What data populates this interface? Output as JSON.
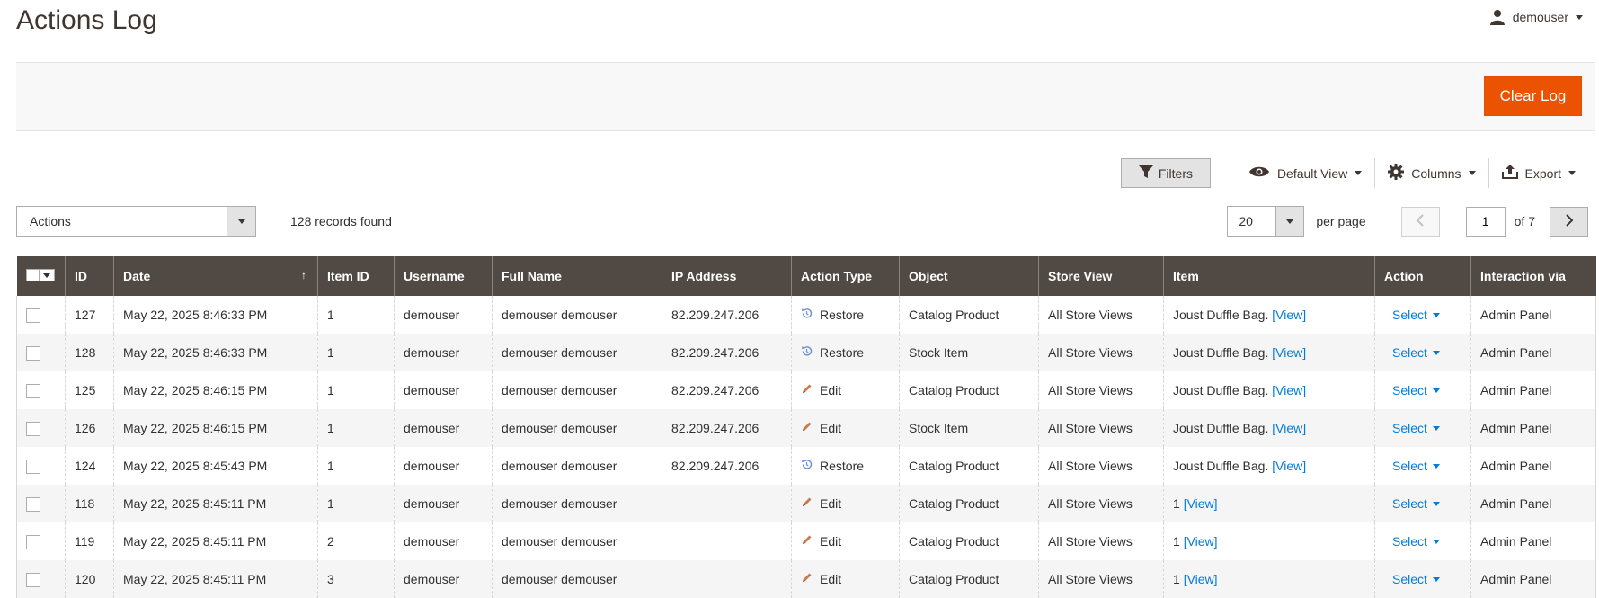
{
  "page": {
    "title": "Actions Log"
  },
  "user": {
    "name": "demouser"
  },
  "buttons": {
    "clear_log": "Clear Log",
    "filters": "Filters"
  },
  "toolbar": {
    "default_view": "Default View",
    "columns": "Columns",
    "export": "Export"
  },
  "mass_actions": {
    "label": "Actions"
  },
  "records_found": "128 records found",
  "pagination": {
    "per_page_value": "20",
    "per_page_label": "per page",
    "current_page": "1",
    "of_pages": "of 7"
  },
  "grid": {
    "columns": [
      "ID",
      "Date",
      "Item ID",
      "Username",
      "Full Name",
      "IP Address",
      "Action Type",
      "Object",
      "Store View",
      "Item",
      "Action",
      "Interaction via"
    ],
    "rows": [
      {
        "id": "127",
        "date": "May 22, 2025 8:46:33 PM",
        "item_id": "1",
        "username": "demouser",
        "full_name": "demouser demouser",
        "ip": "82.209.247.206",
        "action_type": "Restore",
        "action_icon": "restore-icon",
        "object": "Catalog Product",
        "store_view": "All Store Views",
        "item_text": "Joust Duffle Bag.",
        "item_link": "[View]",
        "action": "Select",
        "via": "Admin Panel"
      },
      {
        "id": "128",
        "date": "May 22, 2025 8:46:33 PM",
        "item_id": "1",
        "username": "demouser",
        "full_name": "demouser demouser",
        "ip": "82.209.247.206",
        "action_type": "Restore",
        "action_icon": "restore-icon",
        "object": "Stock Item",
        "store_view": "All Store Views",
        "item_text": "Joust Duffle Bag.",
        "item_link": "[View]",
        "action": "Select",
        "via": "Admin Panel"
      },
      {
        "id": "125",
        "date": "May 22, 2025 8:46:15 PM",
        "item_id": "1",
        "username": "demouser",
        "full_name": "demouser demouser",
        "ip": "82.209.247.206",
        "action_type": "Edit",
        "action_icon": "pencil-icon",
        "object": "Catalog Product",
        "store_view": "All Store Views",
        "item_text": "Joust Duffle Bag.",
        "item_link": "[View]",
        "action": "Select",
        "via": "Admin Panel"
      },
      {
        "id": "126",
        "date": "May 22, 2025 8:46:15 PM",
        "item_id": "1",
        "username": "demouser",
        "full_name": "demouser demouser",
        "ip": "82.209.247.206",
        "action_type": "Edit",
        "action_icon": "pencil-icon",
        "object": "Stock Item",
        "store_view": "All Store Views",
        "item_text": "Joust Duffle Bag.",
        "item_link": "[View]",
        "action": "Select",
        "via": "Admin Panel"
      },
      {
        "id": "124",
        "date": "May 22, 2025 8:45:43 PM",
        "item_id": "1",
        "username": "demouser",
        "full_name": "demouser demouser",
        "ip": "82.209.247.206",
        "action_type": "Restore",
        "action_icon": "restore-icon",
        "object": "Catalog Product",
        "store_view": "All Store Views",
        "item_text": "Joust Duffle Bag.",
        "item_link": "[View]",
        "action": "Select",
        "via": "Admin Panel"
      },
      {
        "id": "118",
        "date": "May 22, 2025 8:45:11 PM",
        "item_id": "1",
        "username": "demouser",
        "full_name": "demouser demouser",
        "ip": "",
        "action_type": "Edit",
        "action_icon": "pencil-icon",
        "object": "Catalog Product",
        "store_view": "All Store Views",
        "item_text": "1",
        "item_link": "[View]",
        "action": "Select",
        "via": "Admin Panel"
      },
      {
        "id": "119",
        "date": "May 22, 2025 8:45:11 PM",
        "item_id": "2",
        "username": "demouser",
        "full_name": "demouser demouser",
        "ip": "",
        "action_type": "Edit",
        "action_icon": "pencil-icon",
        "object": "Catalog Product",
        "store_view": "All Store Views",
        "item_text": "1",
        "item_link": "[View]",
        "action": "Select",
        "via": "Admin Panel"
      },
      {
        "id": "120",
        "date": "May 22, 2025 8:45:11 PM",
        "item_id": "3",
        "username": "demouser",
        "full_name": "demouser demouser",
        "ip": "",
        "action_type": "Edit",
        "action_icon": "pencil-icon",
        "object": "Catalog Product",
        "store_view": "All Store Views",
        "item_text": "1",
        "item_link": "[View]",
        "action": "Select",
        "via": "Admin Panel"
      }
    ]
  },
  "colors": {
    "header_bg": "#514943",
    "accent": "#eb5202",
    "link": "#007bdb"
  }
}
